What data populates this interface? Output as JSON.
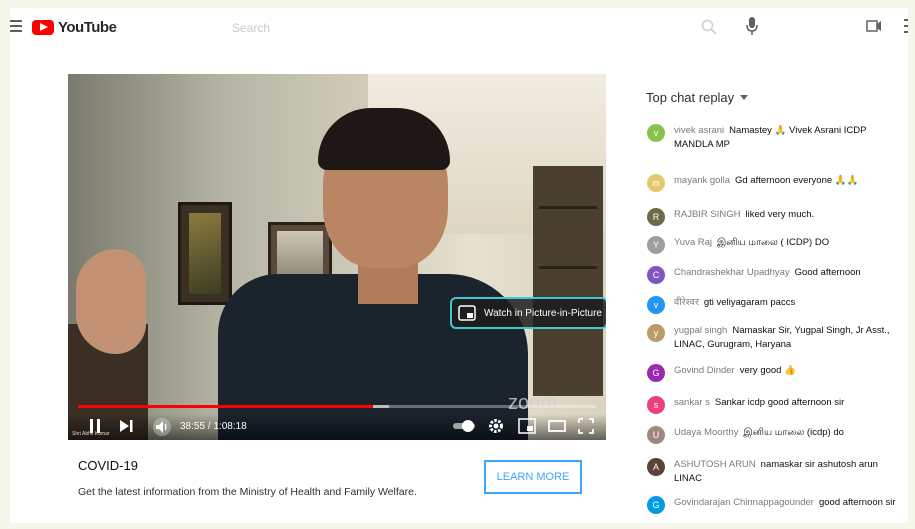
{
  "header": {
    "logo_text": "YouTube",
    "search_placeholder": "Search"
  },
  "player": {
    "pip_label": "Watch in Picture-in-Picture",
    "current_time": "38:55",
    "duration": "1:08:18",
    "time_display": "38:55 / 1:08:18",
    "progress_fraction": 0.57,
    "loaded_fraction": 0.6,
    "watermark": "zoom",
    "speaker_caption": "Shri Abhit Kumar"
  },
  "banner": {
    "title": "COVID-19",
    "description": "Get the latest information from the Ministry of Health and Family Welfare.",
    "cta_label": "LEARN MORE"
  },
  "chat": {
    "header": "Top chat replay",
    "messages": [
      {
        "author": "vivek asrani",
        "text": "Namastey 🙏 Vivek Asrani ICDP MANDLA MP",
        "avatar_color": "#8bc34a",
        "initial": "v"
      },
      {
        "author": "mayank golla",
        "text": "Gd afternoon everyone 🙏🙏",
        "avatar_color": "#e7c86b",
        "initial": "m"
      },
      {
        "author": "RAJBIR SINGH",
        "text": "liked very much.",
        "avatar_color": "#6b6b4a",
        "initial": "R"
      },
      {
        "author": "Yuva Raj",
        "text": "இனிய மாலை ( ICDP) DO",
        "avatar_color": "#9e9e9e",
        "initial": "Y"
      },
      {
        "author": "Chandrashekhar Upadhyay",
        "text": "Good afternoon",
        "avatar_color": "#7e57c2",
        "initial": "C"
      },
      {
        "author": "वीरेश्वर",
        "text": "gti veliyagaram paccs",
        "avatar_color": "#2196f3",
        "initial": "v"
      },
      {
        "author": "yugpal singh",
        "text": "Namaskar Sir, Yugpal Singh, Jr Asst., LINAC, Gurugram, Haryana",
        "avatar_color": "#bc9b6a",
        "initial": "y"
      },
      {
        "author": "Govind Dinder",
        "text": "very good 👍",
        "avatar_color": "#9c27b0",
        "initial": "G"
      },
      {
        "author": "sankar s",
        "text": "Sankar icdp good afternoon sir",
        "avatar_color": "#ec407a",
        "initial": "s"
      },
      {
        "author": "Udaya Moorthy",
        "text": "இனிய மாலை (icdp) do",
        "avatar_color": "#a1887f",
        "initial": "U"
      },
      {
        "author": "ASHUTOSH ARUN",
        "text": "namaskar sir ashutosh arun LINAC",
        "avatar_color": "#5d4037",
        "initial": "A"
      },
      {
        "author": "Govindarajan Chinnappagounder",
        "text": "good afternoon sir",
        "avatar_color": "#039be5",
        "initial": "G"
      }
    ]
  }
}
